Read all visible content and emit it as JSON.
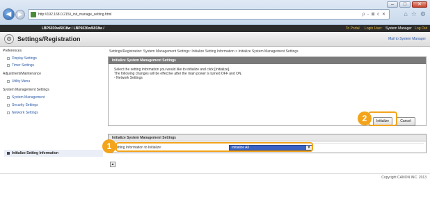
{
  "browser": {
    "url": "http://192.168.0.215/i_init_manage_setting.html",
    "address_tools": "ρ - ⊠ c ✕",
    "icons": [
      "home-icon",
      "star-icon",
      "gear-icon"
    ]
  },
  "header": {
    "model": "LBP6030w/6018w / LBP6030w/6018w /",
    "portal": "To Portal",
    "login_label": "Login User:",
    "user": "System Manager",
    "logout": "Log Out"
  },
  "titlebar": {
    "title": "Settings/Registration",
    "mail": "Mail to System Manager"
  },
  "sidebar": {
    "preferences": "Preferences",
    "display_settings": "Display Settings",
    "timer_settings": "Timer Settings",
    "adjustment": "Adjustment/Maintenance",
    "utility_menu": "Utility Menu",
    "sys_mgmt_settings": "System Management Settings",
    "system_management": "System Management",
    "security_settings": "Security Settings",
    "network_settings": "Network Settings",
    "init_setting_info": "Initialize Setting Information"
  },
  "breadcrumb": "Settings/Registration: System Management Settings: Initialize Setting Information > Initialize System Management Settings",
  "panel1": {
    "title": "Initialize System Management Settings",
    "line1": "Select the setting information you would like to initialize and click [Initialize].",
    "line2": "The following changes will be effective after the main power is turned OFF and ON.",
    "line3": "- Network Settings",
    "initialize_button": "Initialize",
    "cancel_button": "Cancel"
  },
  "panel2": {
    "title": "Initialize System Management Settings",
    "field_label": "Setting Information to Initialize:",
    "field_value": "Initialize All"
  },
  "markers": {
    "one": "1",
    "two": "2"
  },
  "footer": {
    "copyright": "Copyright CANON INC. 2013"
  },
  "colors": {
    "highlight": "#f3a41b",
    "link": "#2a59a6",
    "header_bg": "#2b2b2b"
  }
}
